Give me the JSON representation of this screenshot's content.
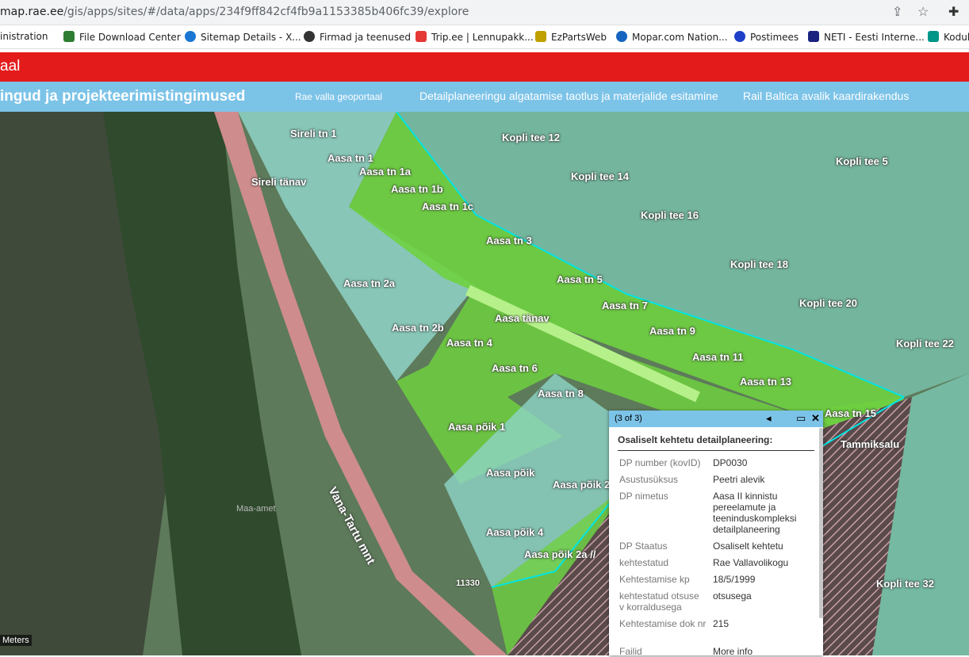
{
  "browser": {
    "url_host": "map.rae.ee",
    "url_path": "/gis/apps/sites/#/data/apps/234f9ff842cf4fb9a1153385b406fc39/explore",
    "share_icon": "share-icon",
    "star_icon": "star-icon",
    "extensions_icon": "puzzle-icon"
  },
  "bookmarks": [
    {
      "label": "inistration",
      "color": "#888888"
    },
    {
      "label": "File Download Center",
      "color": "#2e7d32"
    },
    {
      "label": "Sitemap Details - X...",
      "color": "#1976d2"
    },
    {
      "label": "Firmad ja teenused",
      "color": "#333333"
    },
    {
      "label": "Trip.ee | Lennupakk...",
      "color": "#e53935"
    },
    {
      "label": "EzPartsWeb",
      "color": "#c0a000"
    },
    {
      "label": "Mopar.com Nation...",
      "color": "#1565c0"
    },
    {
      "label": "Postimees",
      "color": "#1e40c8"
    },
    {
      "label": "NETI - Eesti Interne...",
      "color": "#1a237e"
    },
    {
      "label": "Kodul",
      "color": "#009688"
    }
  ],
  "app": {
    "title_fragment": "aal",
    "nav_title": "ingud ja projekteerimistingimused",
    "nav_links": [
      "Rae valla geoportaal",
      "Detailplaneeringu algatamise taotlus ja materjalide esitamine",
      "Rail Baltica avalik kaardirakendus"
    ]
  },
  "map": {
    "road_name": "Vana-Tartu mnt",
    "road_number": "11330",
    "watermark": "Maa-amet",
    "scale_unit": "Meters",
    "colors": {
      "parcel_green": "#7ed957",
      "parcel_teal": "#8fd4c8",
      "boundary": "#00e5e5",
      "road": "#e09090"
    },
    "labels": [
      "Sireli tn 1",
      "Sireli tänav",
      "Aasa tn 1",
      "Aasa tn 1a",
      "Aasa tn 1b",
      "Aasa tn 1c",
      "Aasa tn 3",
      "Aasa tn 2a",
      "Aasa tn 2b",
      "Aasa tn 4",
      "Aasa tn 5",
      "Aasa tänav",
      "Aasa tn 6",
      "Aasa tn 7",
      "Aasa tn 8",
      "Aasa tn 9",
      "Aasa tn 11",
      "Aasa tn 13",
      "Aasa tn 15",
      "Aasa põik 1",
      "Aasa põik",
      "Aasa põik 2",
      "Aasa põik 4",
      "Aasa põik 2a //",
      "Kopli tee 12",
      "Kopli tee 14",
      "Kopli tee 16",
      "Kopli tee 18",
      "Kopli tee 20",
      "Kopli tee 22",
      "Kopli tee 5",
      "Kopli tee 32",
      "Tammiksalu"
    ]
  },
  "popup": {
    "count": "(3 of 3)",
    "title": "Osaliselt kehtetu detailplaneering:",
    "rows": [
      {
        "k": "DP number (kovID)",
        "v": "DP0030"
      },
      {
        "k": "Asustusüksus",
        "v": "Peetri alevik"
      },
      {
        "k": "DP nimetus",
        "v": "Aasa II kinnistu pereelamute ja teeninduskompleksi detailplaneering"
      },
      {
        "k": "DP Staatus",
        "v": "Osaliselt kehtetu"
      },
      {
        "k": "kehtestatud",
        "v": "Rae Vallavolikogu"
      },
      {
        "k": "Kehtestamise kp",
        "v": "18/5/1999"
      },
      {
        "k": "kehtestatud otsuse v korraldusega",
        "v": "otsusega"
      },
      {
        "k": "Kehtestamise dok nr",
        "v": "215"
      },
      {
        "k": "Failid",
        "v": "More info"
      }
    ]
  }
}
